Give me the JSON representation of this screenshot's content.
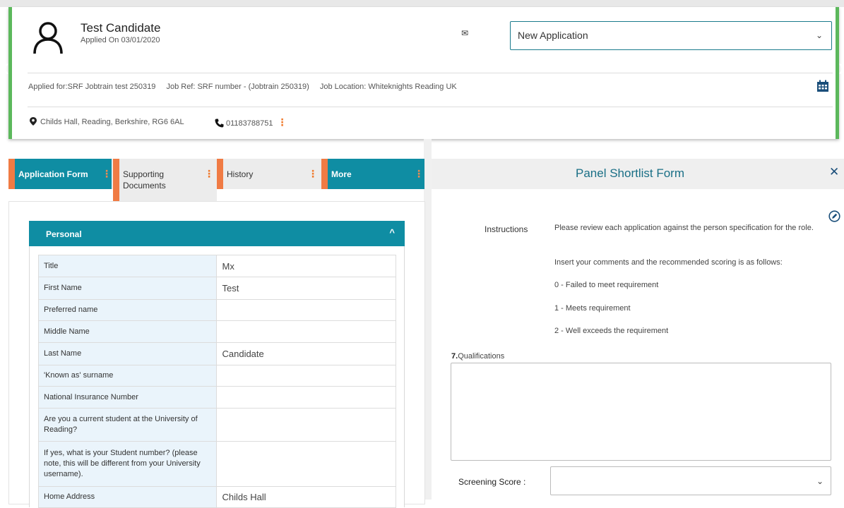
{
  "candidate": {
    "name": "Test Candidate",
    "applied_on": "Applied On 03/01/2020",
    "status_value": "New Application",
    "job_for": "Applied for:SRF Jobtrain test 250319",
    "job_ref": "Job Ref: SRF number - (Jobtrain 250319)",
    "job_location": "Job Location: Whiteknights Reading UK",
    "address": "Childs Hall, Reading, Berkshire, RG6 6AL",
    "phone": "01183788751"
  },
  "icons": {
    "avatar": "user-icon",
    "mail": "envelope-icon",
    "calendar": "calendar-icon",
    "location": "map-pin-icon",
    "phone": "phone-icon",
    "more": "kebab-icon",
    "close": "close-icon",
    "edit": "edit-icon"
  },
  "tabs": [
    {
      "label": "Application Form",
      "active": true
    },
    {
      "label": "Supporting Documents",
      "active": false
    },
    {
      "label": "History",
      "active": false
    },
    {
      "label": "More",
      "active": true
    }
  ],
  "section": {
    "title": "Personal"
  },
  "personal_fields": [
    {
      "label": "Title",
      "value": "Mx"
    },
    {
      "label": "First Name",
      "value": "Test"
    },
    {
      "label": "Preferred name",
      "value": ""
    },
    {
      "label": "Middle Name",
      "value": ""
    },
    {
      "label": "Last Name",
      "value": "Candidate"
    },
    {
      "label": "'Known as' surname",
      "value": ""
    },
    {
      "label": "National Insurance Number",
      "value": ""
    },
    {
      "label": "Are you a current student at the University of Reading?",
      "value": ""
    },
    {
      "label": "If yes, what is your Student number? (please note, this will be different from your University username).",
      "value": ""
    },
    {
      "label": "Home Address",
      "value": "Childs Hall"
    }
  ],
  "panel": {
    "title": "Panel Shortlist Form",
    "instructions_label": "Instructions",
    "instructions": [
      "Please review each application against the person specification for the role.",
      "Insert your comments and the recommended scoring is as follows:",
      "0 - Failed to meet requirement",
      "1 - Meets requirement",
      "2 - Well exceeds the requirement"
    ],
    "question_number": "7.",
    "question_label": "Qualifications",
    "answer_value": "",
    "score_label": "Screening Score :",
    "score_value": ""
  },
  "colors": {
    "accent_teal": "#0f8da3",
    "tab_marker_orange": "#f07b44",
    "header_border_green": "#5cb85c",
    "title_teal": "#1a6f86"
  }
}
